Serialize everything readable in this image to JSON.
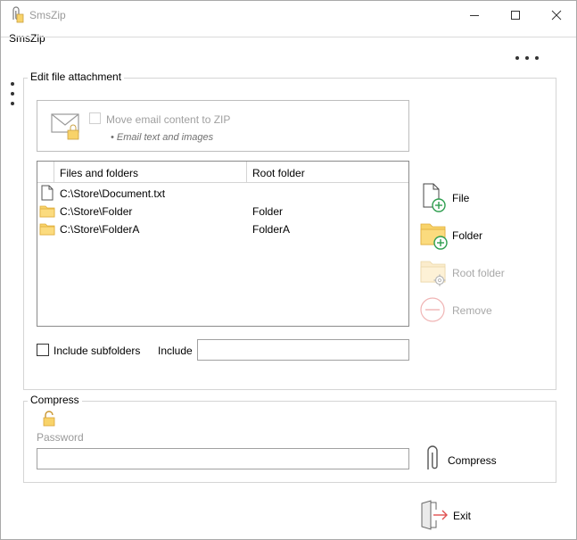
{
  "window": {
    "title": "SmsZip"
  },
  "menu": {
    "label": "SmsZip"
  },
  "edit_group": {
    "title": "Edit file attachment",
    "email": {
      "checkbox_label": "Move email content to ZIP",
      "bullet": "• Email text and images",
      "checked": false,
      "enabled": false
    },
    "list": {
      "columns": [
        "Files and folders",
        "Root folder"
      ],
      "rows": [
        {
          "type": "file",
          "icon": "document-icon",
          "path": "C:\\Store\\Document.txt",
          "root": ""
        },
        {
          "type": "folder",
          "icon": "folder-icon",
          "path": "C:\\Store\\Folder",
          "root": "Folder"
        },
        {
          "type": "folder",
          "icon": "folder-icon",
          "path": "C:\\Store\\FolderA",
          "root": "FolderA"
        }
      ]
    },
    "include_subfolders_label": "Include subfolders",
    "include_subfolders_checked": false,
    "include_label": "Include",
    "include_value": "",
    "buttons": {
      "file": "File",
      "folder": "Folder",
      "root_folder": "Root folder",
      "remove": "Remove"
    }
  },
  "compress_group": {
    "title": "Compress",
    "password_label": "Password",
    "password_value": "",
    "compress_label": "Compress"
  },
  "exit_label": "Exit",
  "colors": {
    "folder": "#f8d36a",
    "folder_dark": "#e8b94a",
    "add_green": "#2e9e4f",
    "exit_red": "#e05050",
    "disabled": "#c8c8c8"
  }
}
